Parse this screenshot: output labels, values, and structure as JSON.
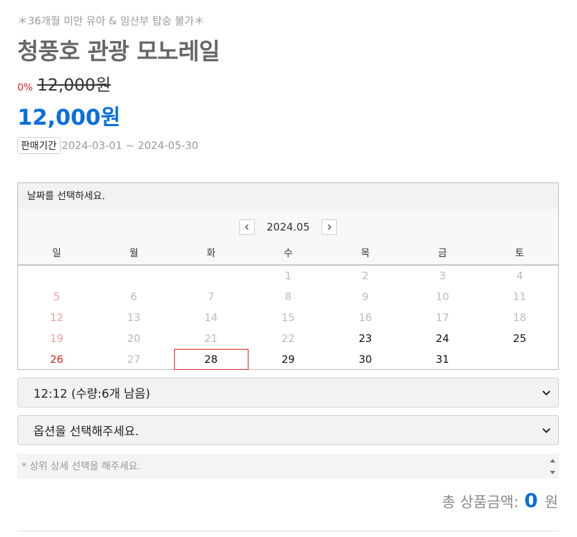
{
  "product": {
    "notice": "＊36개월 미만 유아 & 임산부 탑승 불가＊",
    "title": "청풍호 관광 모노레일",
    "discount": "0%",
    "original_price": "12,000원",
    "sale_price": "12,000원",
    "period_label": "판매기간",
    "period_value": "2024-03-01 ~ 2024-05-30"
  },
  "calendar": {
    "hint": "날짜를 선택하세요.",
    "month": "2024.05",
    "prev_icon": "chevron-left-icon",
    "next_icon": "chevron-right-icon",
    "weekdays": [
      "일",
      "월",
      "화",
      "수",
      "목",
      "금",
      "토"
    ],
    "weeks": [
      [
        {
          "day": "",
          "state": "empty"
        },
        {
          "day": "",
          "state": "empty"
        },
        {
          "day": "",
          "state": "empty"
        },
        {
          "day": "1",
          "state": "off"
        },
        {
          "day": "2",
          "state": "off"
        },
        {
          "day": "3",
          "state": "off"
        },
        {
          "day": "4",
          "state": "off"
        }
      ],
      [
        {
          "day": "5",
          "state": "sun-off"
        },
        {
          "day": "6",
          "state": "off"
        },
        {
          "day": "7",
          "state": "off"
        },
        {
          "day": "8",
          "state": "off"
        },
        {
          "day": "9",
          "state": "off"
        },
        {
          "day": "10",
          "state": "off"
        },
        {
          "day": "11",
          "state": "off"
        }
      ],
      [
        {
          "day": "12",
          "state": "sun-off"
        },
        {
          "day": "13",
          "state": "off"
        },
        {
          "day": "14",
          "state": "off"
        },
        {
          "day": "15",
          "state": "off"
        },
        {
          "day": "16",
          "state": "off"
        },
        {
          "day": "17",
          "state": "off"
        },
        {
          "day": "18",
          "state": "off"
        }
      ],
      [
        {
          "day": "19",
          "state": "sun-off"
        },
        {
          "day": "20",
          "state": "off"
        },
        {
          "day": "21",
          "state": "off"
        },
        {
          "day": "22",
          "state": "off"
        },
        {
          "day": "23",
          "state": "avail"
        },
        {
          "day": "24",
          "state": "avail"
        },
        {
          "day": "25",
          "state": "avail"
        }
      ],
      [
        {
          "day": "26",
          "state": "sun-on"
        },
        {
          "day": "27",
          "state": "off"
        },
        {
          "day": "28",
          "state": "selected"
        },
        {
          "day": "29",
          "state": "avail"
        },
        {
          "day": "30",
          "state": "avail"
        },
        {
          "day": "31",
          "state": "avail"
        },
        {
          "day": "",
          "state": "empty"
        }
      ]
    ]
  },
  "time_select": {
    "value": "12:12 (수량:6개 남음)"
  },
  "option_select": {
    "value": "옵션을 선택해주세요."
  },
  "memo": {
    "placeholder": "* 상위 상세 선택을 해주세요."
  },
  "total": {
    "label": "총 상품금액:",
    "amount": "0",
    "unit": "원"
  },
  "colors": {
    "accent": "#0a6fe0",
    "sunday": "#e02020",
    "selected_border": "#dd2222"
  }
}
